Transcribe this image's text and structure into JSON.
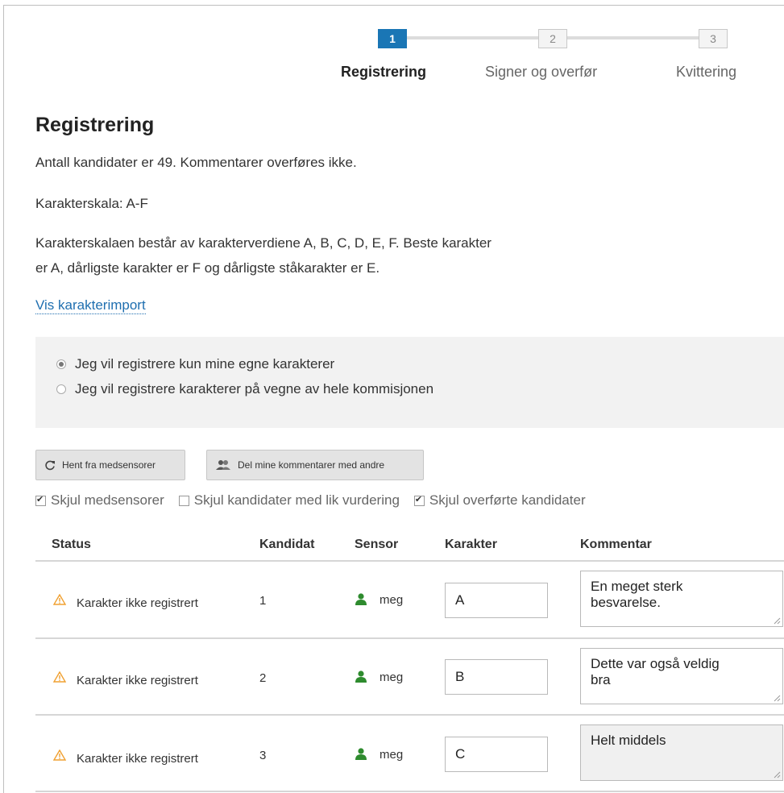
{
  "stepper": {
    "steps": [
      {
        "number": "1",
        "label": "Registrering",
        "active": true
      },
      {
        "number": "2",
        "label": "Signer og overfør",
        "active": false
      },
      {
        "number": "3",
        "label": "Kvittering",
        "active": false
      }
    ]
  },
  "page": {
    "title": "Registrering",
    "info_candidates": "Antall kandidater er 49. Kommentarer overføres ikke.",
    "info_scale": "Karakterskala: A-F",
    "info_scale_desc_line1": "Karakterskalaen består av karakterverdiene A, B, C, D, E, F. Beste karakter",
    "info_scale_desc_line2": "er A, dårligste karakter er F og dårligste ståkarakter er E.",
    "import_link": "Vis karakterimport"
  },
  "radio_options": [
    {
      "label": "Jeg vil registrere kun mine egne karakterer",
      "checked": true
    },
    {
      "label": "Jeg vil registrere karakterer på vegne av hele kommisjonen",
      "checked": false
    }
  ],
  "buttons": {
    "fetch": "Hent fra medsensorer",
    "share": "Del mine kommentarer med andre"
  },
  "filters": [
    {
      "label": "Skjul medsensorer",
      "checked": true
    },
    {
      "label": "Skjul kandidater med lik vurdering",
      "checked": false
    },
    {
      "label": "Skjul overførte kandidater",
      "checked": true
    }
  ],
  "table": {
    "headers": {
      "status": "Status",
      "candidate": "Kandidat",
      "sensor": "Sensor",
      "grade": "Karakter",
      "comment": "Kommentar"
    },
    "rows": [
      {
        "status": "Karakter ikke registrert",
        "candidate": "1",
        "sensor": "meg",
        "grade": "A",
        "comment_line1": "En meget sterk",
        "comment_line2": "besvarelse."
      },
      {
        "status": "Karakter ikke registrert",
        "candidate": "2",
        "sensor": "meg",
        "grade": "B",
        "comment_line1": "Dette var også veldig",
        "comment_line2": "bra"
      },
      {
        "status": "Karakter ikke registrert",
        "candidate": "3",
        "sensor": "meg",
        "grade": "C",
        "comment_line1": "Helt middels",
        "comment_line2": ""
      }
    ]
  },
  "colors": {
    "accent": "#1a76b5",
    "warning": "#f0a030",
    "sensor_icon": "#2e8b2e",
    "link": "#1f6fb0"
  },
  "icons": {
    "fetch": "refresh-icon",
    "share": "users-icon",
    "status": "warning-icon",
    "sensor": "person-icon"
  }
}
